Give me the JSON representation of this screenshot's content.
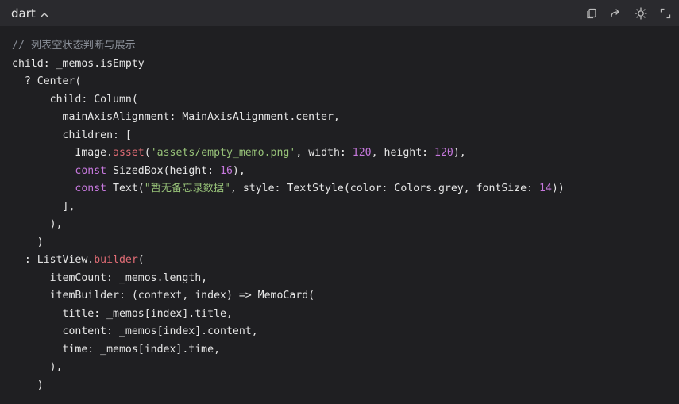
{
  "header": {
    "language": "dart"
  },
  "toolbar": {
    "icons": [
      "copy-icon",
      "share-icon",
      "theme-toggle-icon",
      "expand-icon"
    ]
  },
  "code_lines": [
    [
      {
        "t": "// 列表空状态判断与展示",
        "c": "cmt"
      }
    ],
    [
      {
        "t": "child: _memos.isEmpty",
        "c": ""
      }
    ],
    [
      {
        "t": "  ? Center(",
        "c": ""
      }
    ],
    [
      {
        "t": "      child: Column(",
        "c": ""
      }
    ],
    [
      {
        "t": "        mainAxisAlignment: MainAxisAlignment.center,",
        "c": ""
      }
    ],
    [
      {
        "t": "        children: [",
        "c": ""
      }
    ],
    [
      {
        "t": "          Image.",
        "c": ""
      },
      {
        "t": "asset",
        "c": "fn"
      },
      {
        "t": "(",
        "c": ""
      },
      {
        "t": "'assets/empty_memo.png'",
        "c": "str"
      },
      {
        "t": ", width: ",
        "c": ""
      },
      {
        "t": "120",
        "c": "num"
      },
      {
        "t": ", height: ",
        "c": ""
      },
      {
        "t": "120",
        "c": "num"
      },
      {
        "t": "),",
        "c": ""
      }
    ],
    [
      {
        "t": "          ",
        "c": ""
      },
      {
        "t": "const",
        "c": "kw"
      },
      {
        "t": " SizedBox(height: ",
        "c": ""
      },
      {
        "t": "16",
        "c": "num"
      },
      {
        "t": "),",
        "c": ""
      }
    ],
    [
      {
        "t": "          ",
        "c": ""
      },
      {
        "t": "const",
        "c": "kw"
      },
      {
        "t": " Text(",
        "c": ""
      },
      {
        "t": "\"暂无备忘录数据\"",
        "c": "str"
      },
      {
        "t": ", style: TextStyle(color: Colors.grey, fontSize: ",
        "c": ""
      },
      {
        "t": "14",
        "c": "num"
      },
      {
        "t": "))",
        "c": ""
      }
    ],
    [
      {
        "t": "        ],",
        "c": ""
      }
    ],
    [
      {
        "t": "      ),",
        "c": ""
      }
    ],
    [
      {
        "t": "    )",
        "c": ""
      }
    ],
    [
      {
        "t": "  : ListView.",
        "c": ""
      },
      {
        "t": "builder",
        "c": "fn"
      },
      {
        "t": "(",
        "c": ""
      }
    ],
    [
      {
        "t": "      itemCount: _memos.length,",
        "c": ""
      }
    ],
    [
      {
        "t": "      itemBuilder: (context, index) => MemoCard(",
        "c": ""
      }
    ],
    [
      {
        "t": "        title: _memos[index].title,",
        "c": ""
      }
    ],
    [
      {
        "t": "        content: _memos[index].content,",
        "c": ""
      }
    ],
    [
      {
        "t": "        time: _memos[index].time,",
        "c": ""
      }
    ],
    [
      {
        "t": "      ),",
        "c": ""
      }
    ],
    [
      {
        "t": "    )",
        "c": ""
      }
    ]
  ],
  "colors": {
    "background": "#1f1f22",
    "header_bg": "#2a2a2e",
    "text": "#e6e6e6",
    "comment": "#8a8f98",
    "string": "#98c379",
    "number": "#c678dd",
    "keyword": "#c678dd",
    "method": "#e06c75"
  }
}
